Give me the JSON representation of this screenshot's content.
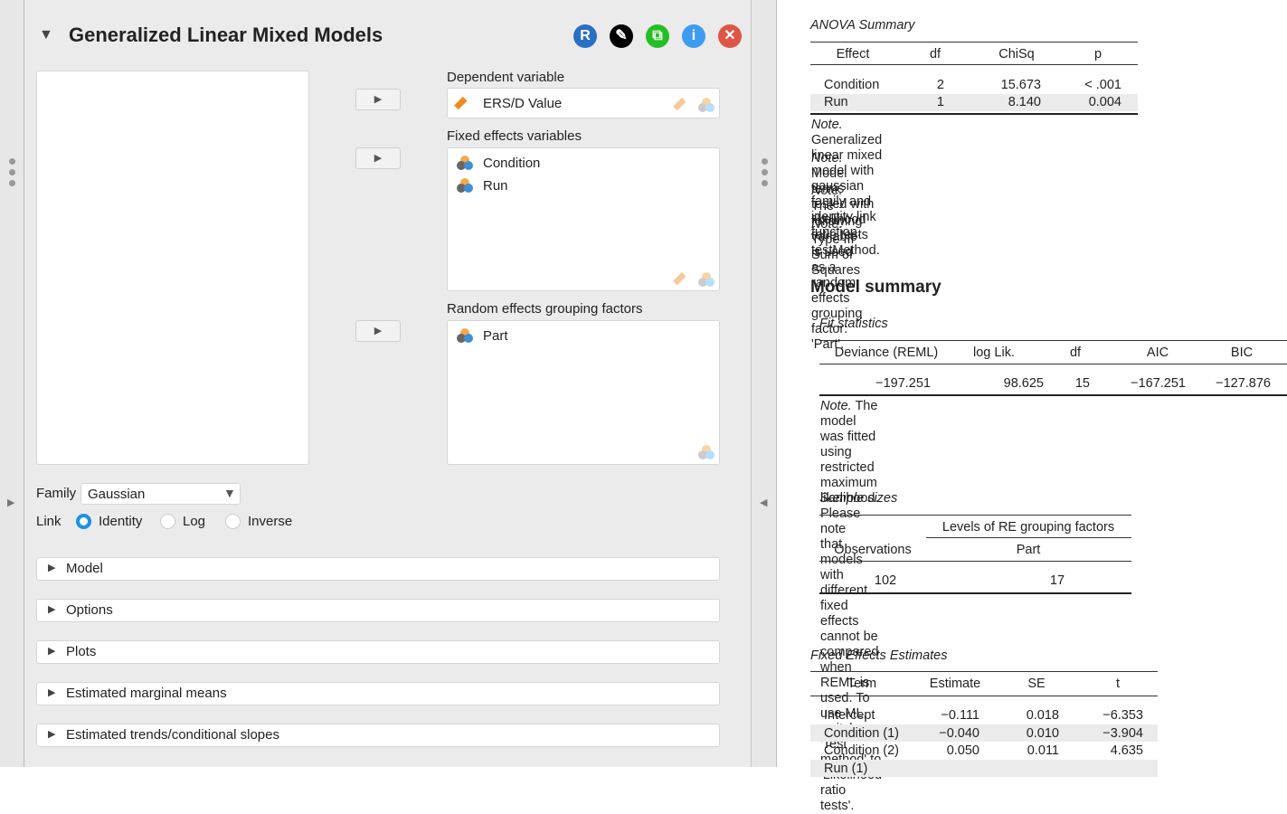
{
  "analysis": {
    "title": "Generalized Linear Mixed Models",
    "icons": [
      {
        "name": "r-syntax-icon",
        "glyph": "R",
        "color": "#2a6fc4"
      },
      {
        "name": "edit-icon",
        "glyph": "✎",
        "color": "#000000"
      },
      {
        "name": "duplicate-icon",
        "glyph": "⧉",
        "color": "#22c022"
      },
      {
        "name": "info-icon",
        "glyph": "i",
        "color": "#3e9cf0"
      },
      {
        "name": "close-icon",
        "glyph": "✕",
        "color": "#dd5544"
      }
    ]
  },
  "vars": {
    "dependent_label": "Dependent variable",
    "dependent": "ERS/D Value",
    "fixed_label": "Fixed effects variables",
    "fixed": [
      "Condition",
      "Run"
    ],
    "random_label": "Random effects grouping factors",
    "random": [
      "Part"
    ]
  },
  "family": {
    "label": "Family",
    "value": "Gaussian"
  },
  "link": {
    "label": "Link",
    "options": [
      "Identity",
      "Log",
      "Inverse"
    ],
    "selected": "Identity"
  },
  "sections": [
    "Model",
    "Options",
    "Plots",
    "Estimated marginal means",
    "Estimated trends/conditional slopes"
  ],
  "anova": {
    "title": "ANOVA Summary",
    "headers": [
      "Effect",
      "df",
      "ChiSq",
      "p"
    ],
    "rows": [
      [
        "Condition",
        "2",
        "15.673",
        "< .001"
      ],
      [
        "Run",
        "1",
        "8.140",
        "0.004"
      ]
    ],
    "notes": [
      [
        "Note.",
        "Generalized linear mixed model with gaussian",
        "family and identity link function."
      ],
      [
        "Note.",
        "Model terms tested with likelihood ratio tests",
        "testMethod."
      ],
      [
        "Note.",
        "The following variable is used as a random",
        "effects grouping factor: 'Part'."
      ],
      [
        "Note.",
        "Type III Sum of Squares",
        ""
      ]
    ]
  },
  "model_summary": {
    "title": "Model summary",
    "fit": {
      "title": "Fit statistics",
      "headers": [
        "Deviance (REML)",
        "log Lik.",
        "df",
        "AIC",
        "BIC"
      ],
      "values": [
        "−197.251",
        "98.625",
        "15",
        "−167.251",
        "−127.876"
      ],
      "note": [
        "Note.",
        "The model was fitted using restricted maximum likelihood. Please note",
        "that models with different fixed effects cannot be compared when REML is",
        "used. To use ML, switch 'Test method' to 'Likelihood ratio tests'."
      ]
    },
    "sample": {
      "title": "Sample sizes",
      "superheader": "Levels of RE grouping factors",
      "headers": [
        "Observations",
        "Part"
      ],
      "values": [
        "102",
        "17"
      ]
    }
  },
  "fixed_estimates": {
    "title": "Fixed Effects Estimates",
    "headers": [
      "Term",
      "Estimate",
      "SE",
      "t"
    ],
    "rows": [
      [
        "Intercept",
        "−0.111",
        "0.018",
        "−6.353"
      ],
      [
        "Condition (1)",
        "−0.040",
        "0.010",
        "−3.904"
      ],
      [
        "Condition (2)",
        "0.050",
        "0.011",
        "4.635"
      ],
      [
        "Run (1)",
        "",
        "",
        ""
      ]
    ]
  }
}
